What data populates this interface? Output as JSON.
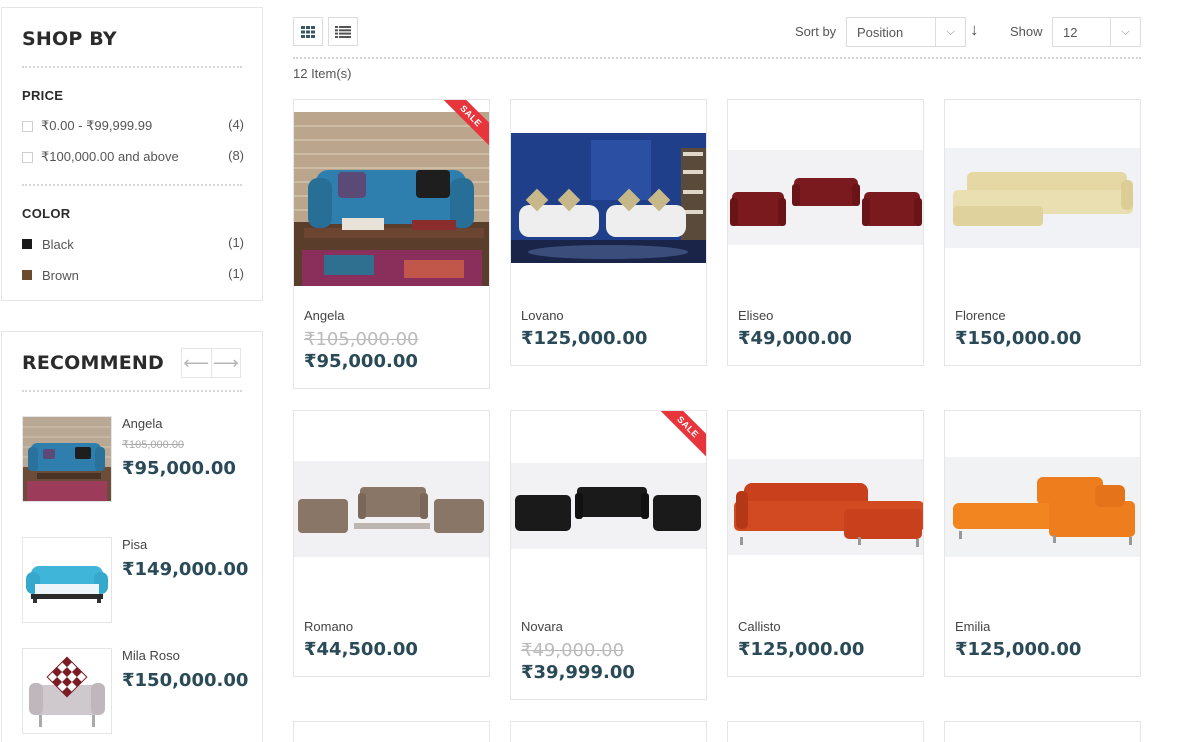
{
  "sidebar": {
    "shop_by": {
      "title": "SHOP BY",
      "price": {
        "title": "PRICE",
        "options": [
          {
            "label": "₹0.00 - ₹99,999.99",
            "count": "(4)"
          },
          {
            "label": "₹100,000.00 and above",
            "count": "(8)"
          }
        ]
      },
      "color": {
        "title": "COLOR",
        "options": [
          {
            "label": "Black",
            "count": "(1)",
            "swatch": "#1a1a1a"
          },
          {
            "label": "Brown",
            "count": "(1)",
            "swatch": "#6b4a2e"
          }
        ]
      }
    },
    "recommend": {
      "title": "RECOMMEND",
      "prev_icon": "arrow-left-icon",
      "next_icon": "arrow-right-icon",
      "items": [
        {
          "name": "Angela",
          "old_price": "₹105,000.00",
          "price": "₹95,000.00"
        },
        {
          "name": "Pisa",
          "old_price": "",
          "price": "₹149,000.00"
        },
        {
          "name": "Mila Roso",
          "old_price": "",
          "price": "₹150,000.00"
        }
      ]
    }
  },
  "toolbar": {
    "grid_icon": "grid-view-icon",
    "list_icon": "list-view-icon",
    "sort_label": "Sort by",
    "sort_value": "Position",
    "sort_dir_icon": "sort-down-arrow-icon",
    "show_label": "Show",
    "show_value": "12",
    "item_count": "12 Item(s)"
  },
  "products": [
    {
      "name": "Angela",
      "old_price": "₹105,000.00",
      "price": "₹95,000.00",
      "sale": "SALE"
    },
    {
      "name": "Lovano",
      "old_price": "",
      "price": "₹125,000.00",
      "sale": ""
    },
    {
      "name": "Eliseo",
      "old_price": "",
      "price": "₹49,000.00",
      "sale": ""
    },
    {
      "name": "Florence",
      "old_price": "",
      "price": "₹150,000.00",
      "sale": ""
    },
    {
      "name": "Romano",
      "old_price": "",
      "price": "₹44,500.00",
      "sale": ""
    },
    {
      "name": "Novara",
      "old_price": "₹49,000.00",
      "price": "₹39,999.00",
      "sale": "SALE"
    },
    {
      "name": "Callisto",
      "old_price": "",
      "price": "₹125,000.00",
      "sale": ""
    },
    {
      "name": "Emilia",
      "old_price": "",
      "price": "₹125,000.00",
      "sale": ""
    }
  ],
  "colors": {
    "price": "#2a4a57",
    "sale_badge": "#e8343b"
  }
}
